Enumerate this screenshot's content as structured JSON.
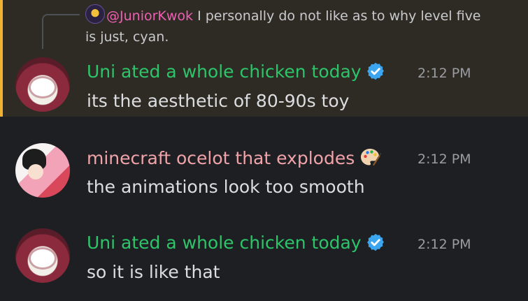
{
  "reply": {
    "mention": "@JuniorKwok",
    "text_line1": " I personally do not like as to why level five",
    "text_line2": "is just, cyan."
  },
  "messages": [
    {
      "author": "Uni ated a whole chicken today",
      "time": "2:12 PM",
      "content": "its the aesthetic of 80-90s toy"
    },
    {
      "author": "minecraft ocelot that explodes",
      "time": "2:12 PM",
      "content": "the animations look too smooth"
    },
    {
      "author": "Uni ated a whole chicken today",
      "time": "2:12 PM",
      "content": "so it is like that"
    }
  ],
  "icons": {
    "verified": "verified-check-icon",
    "role": "art-palette-icon"
  },
  "colors": {
    "background": "#1e1f23",
    "highlight": "#2e2b24",
    "accent_bar": "#f0b232",
    "mention": "#ee5fb2",
    "name_green": "#2dc46a",
    "name_pink": "#f0a3a8",
    "verified_blue": "#3ba5f0"
  }
}
